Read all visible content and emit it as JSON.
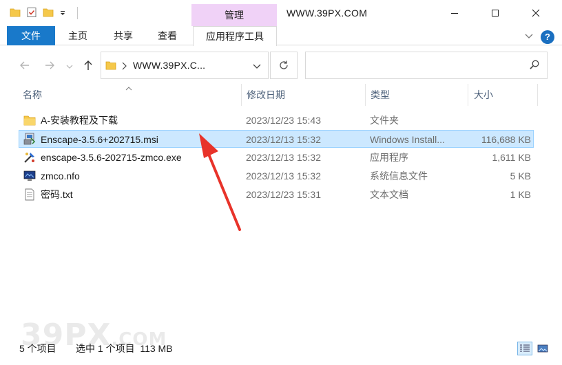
{
  "titlebar": {
    "manage_tab": "管理",
    "title": "WWW.39PX.COM"
  },
  "ribbon": {
    "tabs": [
      {
        "label": "文件"
      },
      {
        "label": "主页"
      },
      {
        "label": "共享"
      },
      {
        "label": "查看"
      },
      {
        "label": "应用程序工具"
      }
    ]
  },
  "nav": {
    "address": "WWW.39PX.C...",
    "search_placeholder": ""
  },
  "columns": {
    "name": "名称",
    "date": "修改日期",
    "type": "类型",
    "size": "大小"
  },
  "files": [
    {
      "name": "A-安装教程及下载",
      "date": "2023/12/23 15:43",
      "type": "文件夹",
      "size": "",
      "icon": "folder-icon"
    },
    {
      "name": "Enscape-3.5.6+202715.msi",
      "date": "2023/12/13 15:32",
      "type": "Windows Install...",
      "size": "116,688 KB",
      "icon": "msi-installer-icon"
    },
    {
      "name": "enscape-3.5.6-202715-zmco.exe",
      "date": "2023/12/13 15:32",
      "type": "应用程序",
      "size": "1,611 KB",
      "icon": "exe-icon"
    },
    {
      "name": "zmco.nfo",
      "date": "2023/12/13 15:32",
      "type": "系统信息文件",
      "size": "5 KB",
      "icon": "nfo-icon"
    },
    {
      "name": "密码.txt",
      "date": "2023/12/23 15:31",
      "type": "文本文档",
      "size": "1 KB",
      "icon": "text-file-icon"
    }
  ],
  "status": {
    "count": "5 个项目",
    "selected": "选中 1 个项目  113 MB"
  },
  "watermark": {
    "main": "39PX",
    "suffix": ".COM"
  },
  "colors": {
    "accent": "#1979ca",
    "manage_tab": "#f0d2f7",
    "selection": "#cce8ff",
    "annotation_arrow": "#e8332a"
  }
}
